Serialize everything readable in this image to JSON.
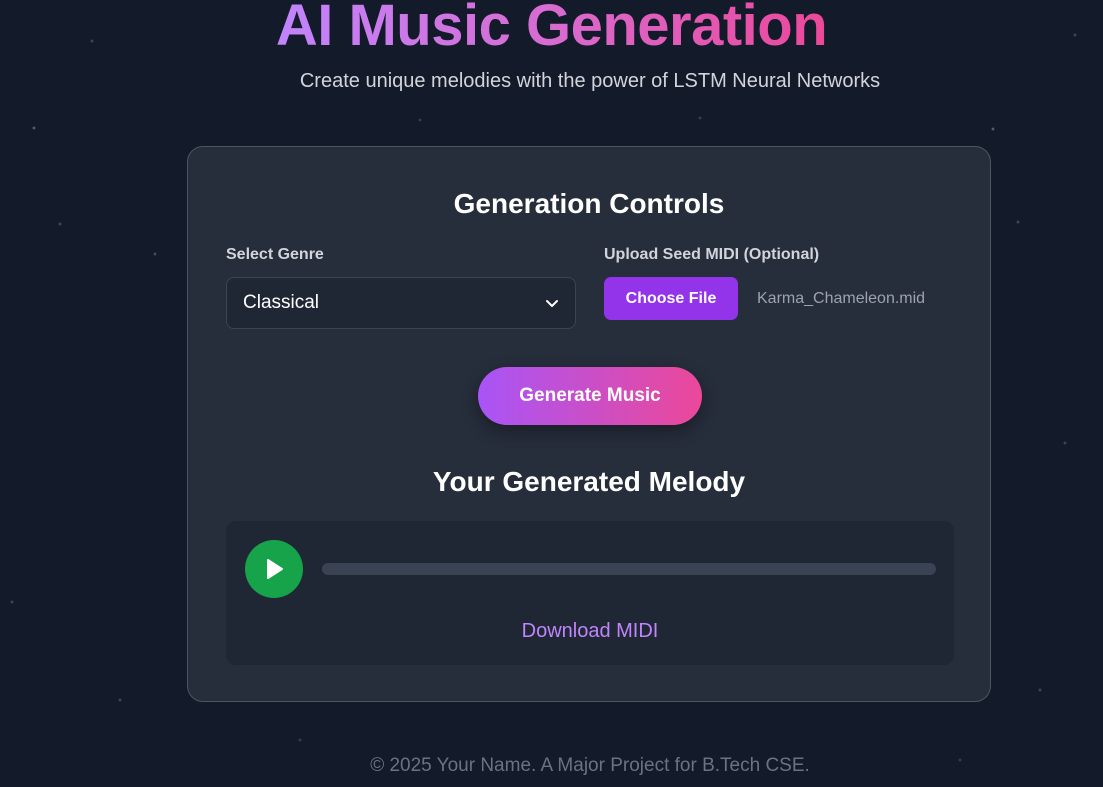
{
  "header": {
    "title": "AI Music Generation",
    "subtitle": "Create unique melodies with the power of LSTM Neural Networks"
  },
  "controls": {
    "title": "Generation Controls",
    "genre_label": "Select Genre",
    "genre_selected": "Classical",
    "upload_label": "Upload Seed MIDI (Optional)",
    "choose_file_label": "Choose File",
    "file_name": "Karma_Chameleon.mid",
    "generate_label": "Generate Music"
  },
  "result": {
    "title": "Your Generated Melody",
    "progress": 0,
    "download_label": "Download MIDI"
  },
  "footer": {
    "text": "© 2025 Your Name. A Major Project for B.Tech CSE."
  },
  "colors": {
    "background": "#131a2a",
    "card": "#262d3b",
    "accent_purple": "#9333ea",
    "accent_pink": "#ec4899",
    "play_green": "#16a34a",
    "link_purple": "#c084fc"
  },
  "icons": {
    "select_arrow": "chevron-down-icon",
    "play": "play-icon"
  }
}
